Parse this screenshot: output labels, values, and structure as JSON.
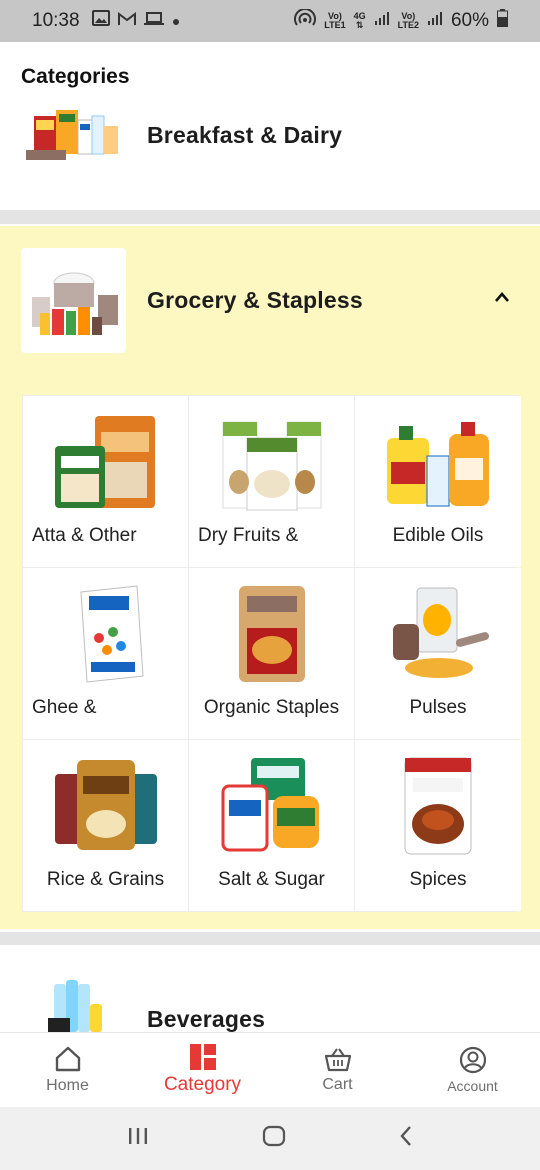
{
  "status_bar": {
    "time": "10:38",
    "net_line1_a": "Vo)",
    "net_line2_a": "LTE1",
    "net_4g": "4G",
    "net_line1_b": "Vo)",
    "net_line2_b": "LTE2",
    "battery": "60%"
  },
  "header": {
    "title": "Categories"
  },
  "categories": {
    "breakfast": {
      "name": "Breakfast & Dairy"
    },
    "grocery": {
      "name": "Grocery & Stapless",
      "expanded": true,
      "subcategories": [
        {
          "label": "Atta & Other",
          "icon": "atta-pack-icon"
        },
        {
          "label": "Dry Fruits &",
          "icon": "dry-fruits-icon"
        },
        {
          "label": "Edible Oils",
          "icon": "oil-can-icon"
        },
        {
          "label": "Ghee &",
          "icon": "ghee-box-icon"
        },
        {
          "label": "Organic Staples",
          "icon": "organic-pouch-icon"
        },
        {
          "label": "Pulses",
          "icon": "pulses-icon"
        },
        {
          "label": "Rice & Grains",
          "icon": "rice-bag-icon"
        },
        {
          "label": "Salt & Sugar",
          "icon": "salt-sugar-icon"
        },
        {
          "label": "Spices",
          "icon": "spice-pack-icon"
        }
      ]
    },
    "beverages": {
      "name": "Beverages"
    }
  },
  "bottom_nav": {
    "items": [
      {
        "label": "Home",
        "icon": "home-icon"
      },
      {
        "label": "Category",
        "icon": "category-icon",
        "active": true
      },
      {
        "label": "Cart",
        "icon": "cart-icon"
      },
      {
        "label": "Account",
        "icon": "account-icon"
      }
    ]
  },
  "colors": {
    "accent": "#e53935",
    "expanded_bg": "#fdf7c2",
    "status_bar_bg": "#c6c6c6"
  }
}
